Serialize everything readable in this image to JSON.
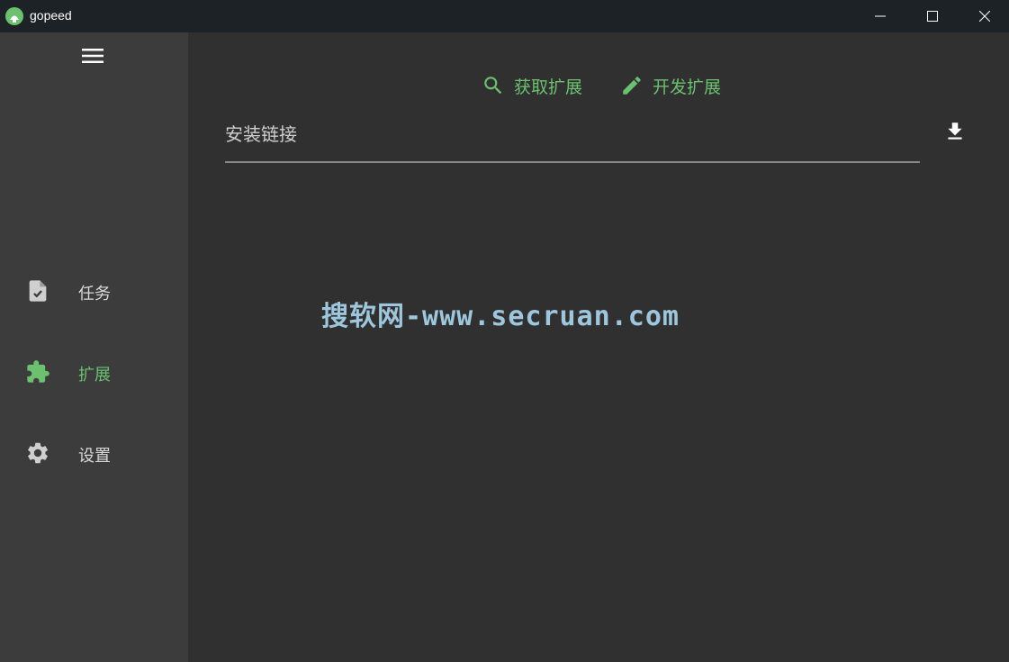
{
  "window": {
    "title": "gopeed",
    "logo_icon": "gopeed-logo-icon",
    "controls": [
      "minimize-icon",
      "maximize-icon",
      "close-icon"
    ]
  },
  "sidebar": {
    "menu_icon": "hamburger-menu-icon",
    "items": [
      {
        "label": "任务",
        "icon": "task-file-check-icon",
        "active": false
      },
      {
        "label": "扩展",
        "icon": "puzzle-extension-icon",
        "active": true
      },
      {
        "label": "设置",
        "icon": "gear-icon",
        "active": false
      }
    ]
  },
  "main": {
    "get_extension_label": "获取扩展",
    "dev_extension_label": "开发扩展",
    "install_placeholder": "安装链接",
    "download_icon": "download-icon",
    "watermark": "搜软网-www.secruan.com"
  },
  "colors": {
    "accent": "#6cc070",
    "titlebar": "#1c2226",
    "sidebar": "#3c3c3c",
    "content": "#303030"
  }
}
